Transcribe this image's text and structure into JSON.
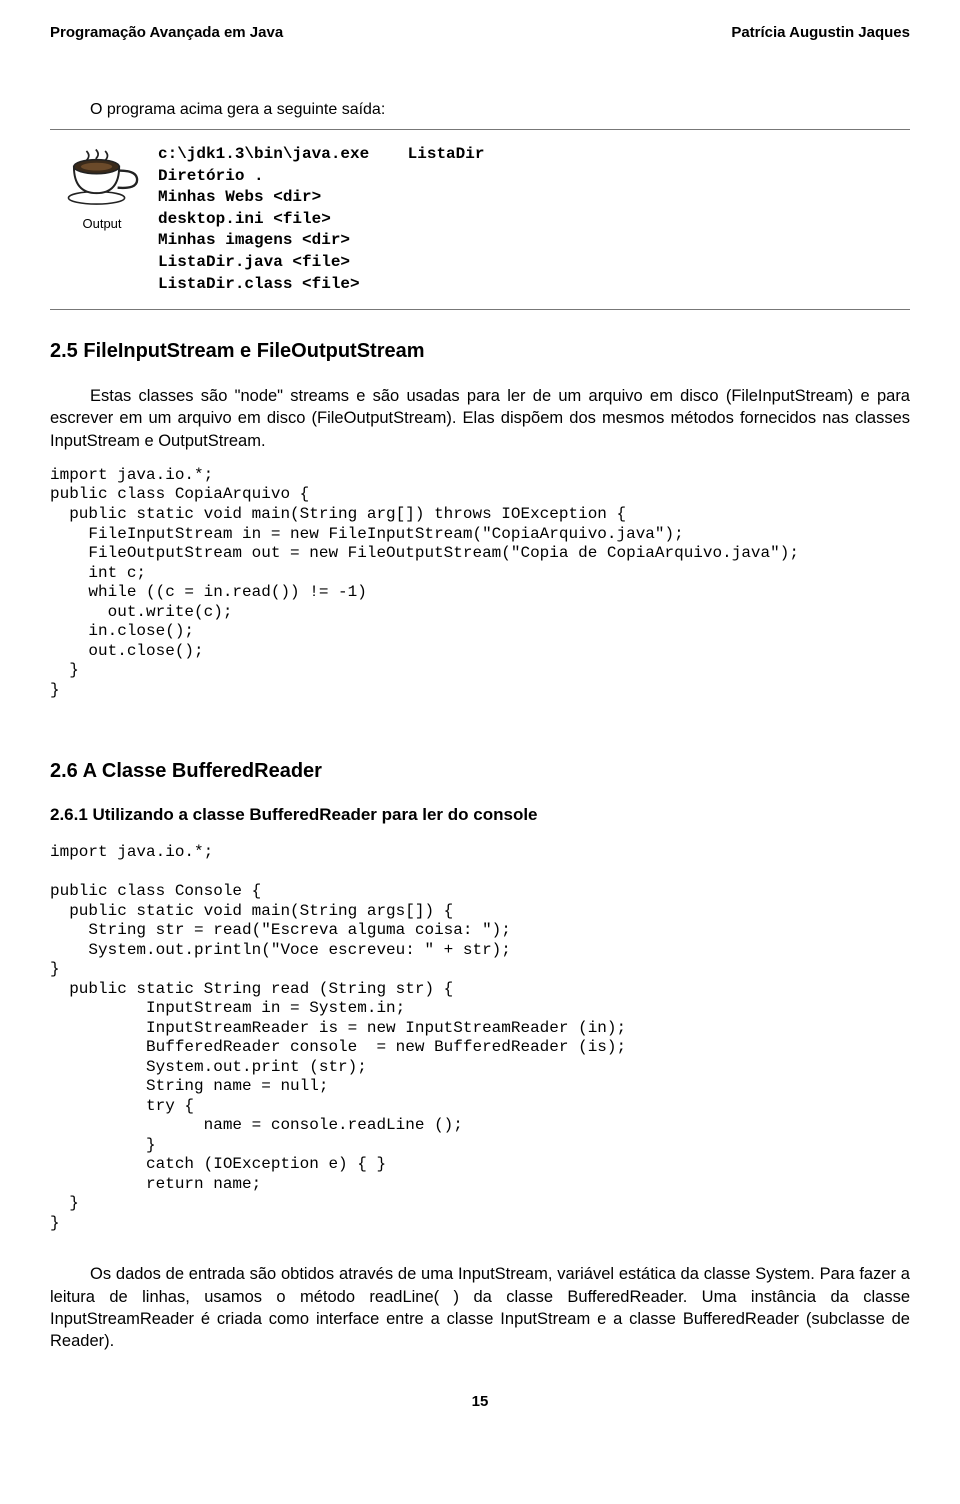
{
  "header": {
    "left": "Programação Avançada em Java",
    "right": "Patrícia Augustin Jaques"
  },
  "intro": "O programa acima gera a seguinte saída:",
  "output_label": "Output",
  "output_text": "c:\\jdk1.3\\bin\\java.exe    ListaDir\nDiretório .\nMinhas Webs <dir>\ndesktop.ini <file>\nMinhas imagens <dir>\nListaDir.java <file>\nListaDir.class <file>",
  "section_2_5": {
    "title": "2.5 FileInputStream e FileOutputStream",
    "para": "Estas classes são \"node\" streams e são usadas para ler de um arquivo em disco (FileInputStream) e para escrever em um arquivo em disco (FileOutputStream). Elas dispõem dos mesmos métodos fornecidos nas classes InputStream e OutputStream.",
    "code": "import java.io.*;\npublic class CopiaArquivo {\n  public static void main(String arg[]) throws IOException {\n    FileInputStream in = new FileInputStream(\"CopiaArquivo.java\");\n    FileOutputStream out = new FileOutputStream(\"Copia de CopiaArquivo.java\");\n    int c;\n    while ((c = in.read()) != -1)\n      out.write(c);\n    in.close();\n    out.close();\n  }\n}"
  },
  "section_2_6": {
    "title": "2.6 A Classe BufferedReader",
    "sub_title": "2.6.1   Utilizando a classe BufferedReader para ler do console",
    "code": "import java.io.*;\n\npublic class Console {\n  public static void main(String args[]) {\n    String str = read(\"Escreva alguma coisa: \");\n    System.out.println(\"Voce escreveu: \" + str);\n}\n  public static String read (String str) {\n          InputStream in = System.in;\n          InputStreamReader is = new InputStreamReader (in);\n          BufferedReader console  = new BufferedReader (is);\n          System.out.print (str);\n          String name = null;\n          try {\n                name = console.readLine ();\n          }\n          catch (IOException e) { }\n          return name;\n  }\n}",
    "para": "Os dados de entrada são obtidos através de uma InputStream, variável estática da classe System. Para fazer a leitura de linhas, usamos o método readLine( ) da classe BufferedReader. Uma instância da classe InputStreamReader é criada como interface entre a classe InputStream e a classe BufferedReader (subclasse de Reader)."
  },
  "page_number": "15"
}
